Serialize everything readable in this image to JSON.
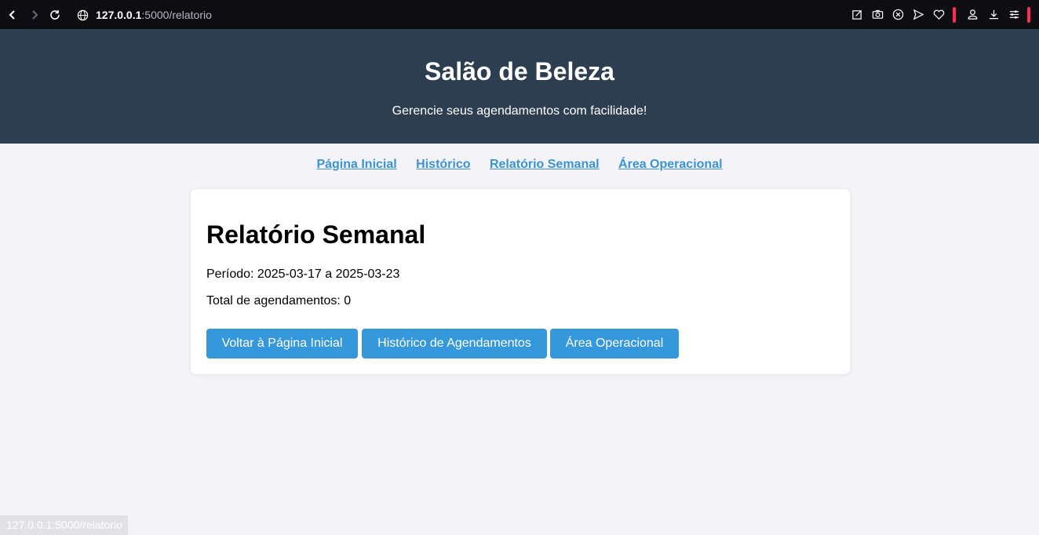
{
  "browser": {
    "url_host": "127.0.0.1",
    "url_path": ":5000/relatorio",
    "icons": [
      "back-icon",
      "forward-icon",
      "reload-icon",
      "globe-icon",
      "edit-icon",
      "camera-icon",
      "close-circle-icon",
      "send-icon",
      "heart-icon",
      "profile-icon",
      "download-icon",
      "menu-icon"
    ]
  },
  "header": {
    "title": "Salão de Beleza",
    "subtitle": "Gerencie seus agendamentos com facilidade!"
  },
  "nav": {
    "home": "Página Inicial",
    "history": "Histórico",
    "weekly_report": "Relatório Semanal",
    "operational": "Área Operacional"
  },
  "report": {
    "title": "Relatório Semanal",
    "period": "Período: 2025-03-17 a 2025-03-23",
    "total": "Total de agendamentos: 0"
  },
  "buttons": {
    "back_home": "Voltar à Página Inicial",
    "history": "Histórico de Agendamentos",
    "operational": "Área Operacional"
  },
  "status_bar": {
    "url": "127.0.0.1:5000/relatorio"
  },
  "colors": {
    "header_bg": "#2c3e50",
    "accent": "#3498db",
    "page_bg": "#f4f4f8"
  }
}
